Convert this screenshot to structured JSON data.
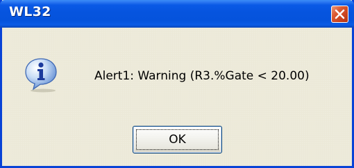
{
  "window": {
    "title": "WL32"
  },
  "dialog": {
    "icon": "info-icon",
    "message": "Alert1: Warning (R3.%Gate < 20.00)",
    "ok_label": "OK"
  },
  "colors": {
    "titlebar": "#0654de",
    "frame": "#0842d6",
    "close_button": "#dc5a32",
    "dialog_background": "#ece9d8"
  }
}
